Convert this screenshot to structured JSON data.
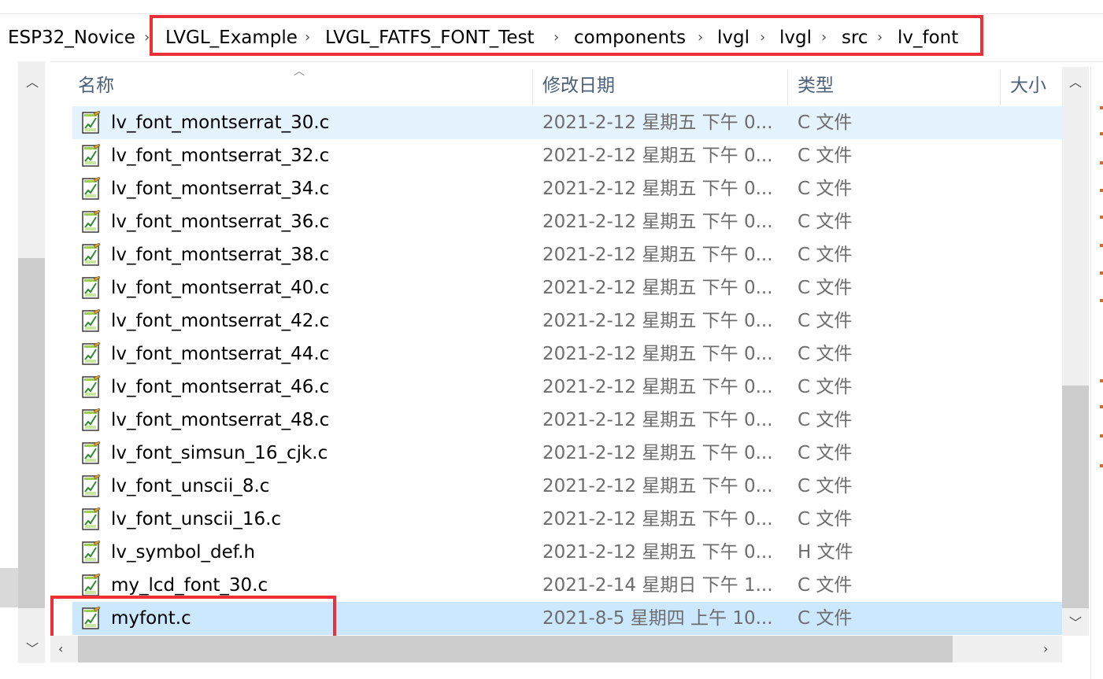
{
  "breadcrumb": {
    "items": [
      "ESP32_Novice",
      "LVGL_Example",
      "LVGL_FATFS_FONT_Test",
      "components",
      "lvgl",
      "lvgl",
      "src",
      "lv_font"
    ],
    "separator": "›"
  },
  "columns": {
    "name": "名称",
    "date": "修改日期",
    "type": "类型",
    "size": "大小"
  },
  "files": [
    {
      "name": "lv_font_montserrat_30.c",
      "date": "2021-2-12 星期五 下午 0...",
      "type": "C 文件"
    },
    {
      "name": "lv_font_montserrat_32.c",
      "date": "2021-2-12 星期五 下午 0...",
      "type": "C 文件"
    },
    {
      "name": "lv_font_montserrat_34.c",
      "date": "2021-2-12 星期五 下午 0...",
      "type": "C 文件"
    },
    {
      "name": "lv_font_montserrat_36.c",
      "date": "2021-2-12 星期五 下午 0...",
      "type": "C 文件"
    },
    {
      "name": "lv_font_montserrat_38.c",
      "date": "2021-2-12 星期五 下午 0...",
      "type": "C 文件"
    },
    {
      "name": "lv_font_montserrat_40.c",
      "date": "2021-2-12 星期五 下午 0...",
      "type": "C 文件"
    },
    {
      "name": "lv_font_montserrat_42.c",
      "date": "2021-2-12 星期五 下午 0...",
      "type": "C 文件"
    },
    {
      "name": "lv_font_montserrat_44.c",
      "date": "2021-2-12 星期五 下午 0...",
      "type": "C 文件"
    },
    {
      "name": "lv_font_montserrat_46.c",
      "date": "2021-2-12 星期五 下午 0...",
      "type": "C 文件"
    },
    {
      "name": "lv_font_montserrat_48.c",
      "date": "2021-2-12 星期五 下午 0...",
      "type": "C 文件"
    },
    {
      "name": "lv_font_simsun_16_cjk.c",
      "date": "2021-2-12 星期五 下午 0...",
      "type": "C 文件"
    },
    {
      "name": "lv_font_unscii_8.c",
      "date": "2021-2-12 星期五 下午 0...",
      "type": "C 文件"
    },
    {
      "name": "lv_font_unscii_16.c",
      "date": "2021-2-12 星期五 下午 0...",
      "type": "C 文件"
    },
    {
      "name": "lv_symbol_def.h",
      "date": "2021-2-12 星期五 下午 0...",
      "type": "H 文件"
    },
    {
      "name": "my_lcd_font_30.c",
      "date": "2021-2-14 星期日 下午 1...",
      "type": "C 文件"
    },
    {
      "name": "myfont.c",
      "date": "2021-8-5 星期四 上午 10...",
      "type": "C 文件"
    }
  ],
  "icons": {
    "file": "c-source-file-icon",
    "scroll_up": "chevron-up-icon",
    "scroll_down": "chevron-down-icon",
    "scroll_left": "chevron-left-icon",
    "scroll_right": "chevron-right-icon",
    "sort": "sort-up-icon"
  },
  "colors": {
    "highlight_box": "#ee2f38",
    "row_selected": "#cce8ff",
    "row_hover": "#e5f3ff",
    "header_text": "#4c607a"
  }
}
